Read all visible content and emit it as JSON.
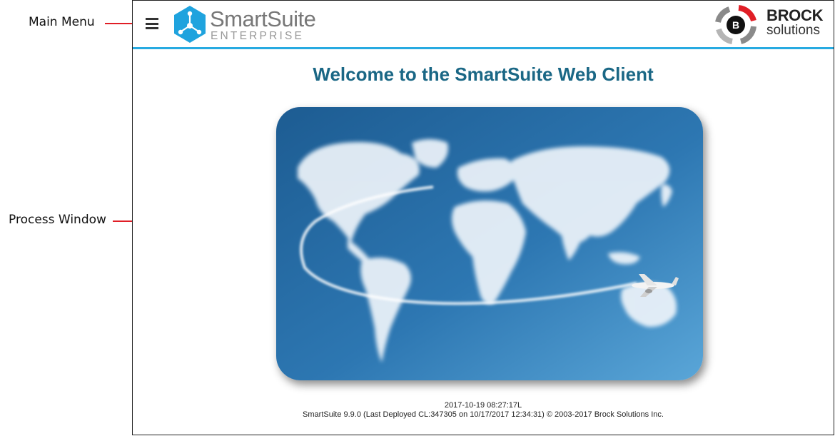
{
  "annotations": {
    "main_menu": "Main Menu",
    "process_window": "Process Window",
    "line_color": "#e01e26"
  },
  "header": {
    "menu_icon": "hamburger-menu-icon",
    "app_logo": {
      "icon": "hexagon-network-icon",
      "name": "SmartSuite",
      "edition": "ENTERPRISE",
      "color": "#1fa3de"
    },
    "company_logo": {
      "initial": "B",
      "name": "BROCK",
      "suffix": "solutions",
      "accent_color": "#e01e26"
    },
    "divider_color": "#27aae1"
  },
  "main": {
    "welcome_title": "Welcome to the SmartSuite Web Client",
    "hero_image": "world-map-clouds-airplane-image"
  },
  "footer": {
    "timestamp": "2017-10-19 08:27:17L",
    "version_info": "SmartSuite 9.9.0 (Last Deployed CL:347305 on 10/17/2017 12:34:31) © 2003-2017 Brock Solutions Inc."
  }
}
